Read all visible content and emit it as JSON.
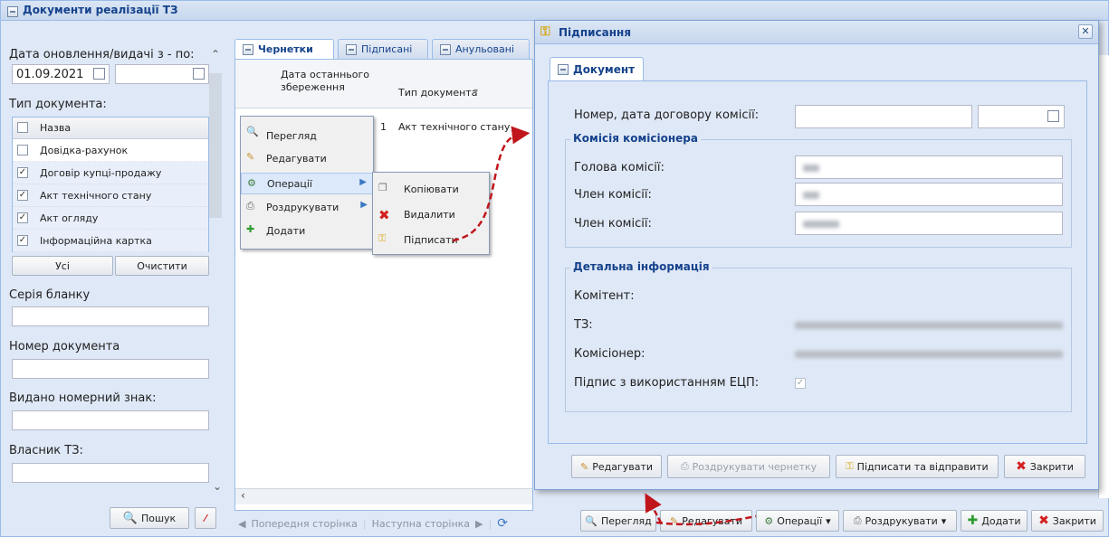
{
  "window": {
    "title": "Документи реалізації ТЗ"
  },
  "filter": {
    "date_label": "Дата оновлення/видачі з - по:",
    "date_from": "01.09.2021",
    "date_to": "",
    "doc_type_label": "Тип документа:",
    "types_header": "Назва",
    "types": [
      {
        "label": "Довідка-рахунок",
        "checked": false
      },
      {
        "label": "Договір купці-продажу",
        "checked": true
      },
      {
        "label": "Акт технічного стану",
        "checked": true
      },
      {
        "label": "Акт огляду",
        "checked": true
      },
      {
        "label": "Інформаційна картка",
        "checked": true
      }
    ],
    "all_btn": "Усі",
    "clear_btn": "Очистити",
    "series_label": "Серія бланку",
    "docnum_label": "Номер документа",
    "plate_label": "Видано номерний знак:",
    "owner_label": "Власник ТЗ:",
    "search_btn": "Пошук"
  },
  "tabs": [
    "Чернетки",
    "Підписані",
    "Анульовані"
  ],
  "grid": {
    "col1": "Дата останнього збереження",
    "col2": "Тип документа",
    "row_date_fragment": "1",
    "row_type": "Акт технічного стану"
  },
  "context_menu": [
    "Перегляд",
    "Редагувати",
    "Операції",
    "Роздрукувати",
    "Додати"
  ],
  "submenu": [
    "Копіювати",
    "Видалити",
    "Підписати"
  ],
  "pager": {
    "prev": "Попередня сторінка",
    "next": "Наступна сторінка"
  },
  "bottom_toolbar": [
    "Перегляд",
    "Редагувати",
    "Операції",
    "Роздрукувати",
    "Додати",
    "Закрити"
  ],
  "dialog": {
    "title": "Підписання",
    "tab": "Документ",
    "contract_label": "Номер, дата договору комісії:",
    "commission_legend": "Комісія комісіонера",
    "head_label": "Голова комісії:",
    "member1_label": "Член комісії:",
    "member2_label": "Член комісії:",
    "details_legend": "Детальна інформація",
    "komitent_label": "Комітент:",
    "ts_label": "ТЗ:",
    "komisioner_label": "Комісіонер:",
    "eds_label": "Підпис з використанням ЕЦП:",
    "buttons": [
      "Редагувати",
      "Роздрукувати чернетку",
      "Підписати та відправити",
      "Закрити"
    ]
  }
}
